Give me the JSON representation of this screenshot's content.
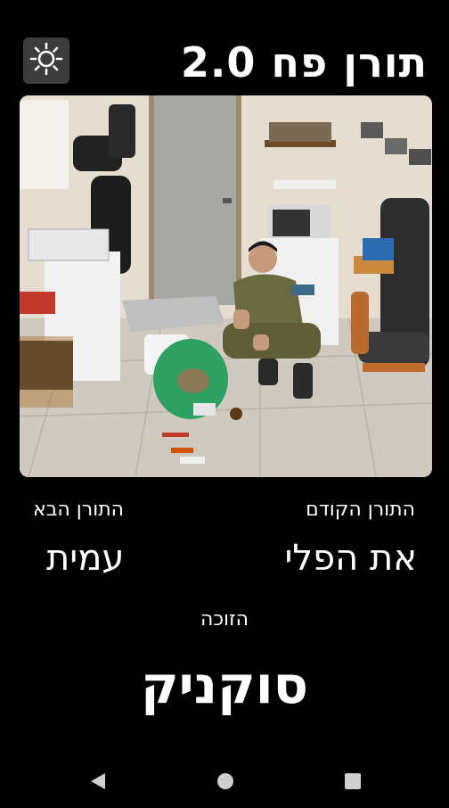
{
  "header": {
    "title": "תורן פח 2.0",
    "theme_icon": "sun-icon"
  },
  "photo": {
    "description_icon": "photo"
  },
  "previous": {
    "label": "התורן הקודם",
    "name": "את הפלי"
  },
  "next": {
    "label": "התורן הבא",
    "name": "עמית"
  },
  "winner": {
    "label": "הזוכה",
    "name": "סוקניק"
  },
  "navbar": {
    "back_icon": "back-triangle-icon",
    "home_icon": "home-circle-icon",
    "recents_icon": "recents-square-icon"
  },
  "colors": {
    "background": "#000000",
    "text": "#ffffff",
    "toggle_bg": "#3c3c3c",
    "nav_icon": "#cfcfcf"
  }
}
